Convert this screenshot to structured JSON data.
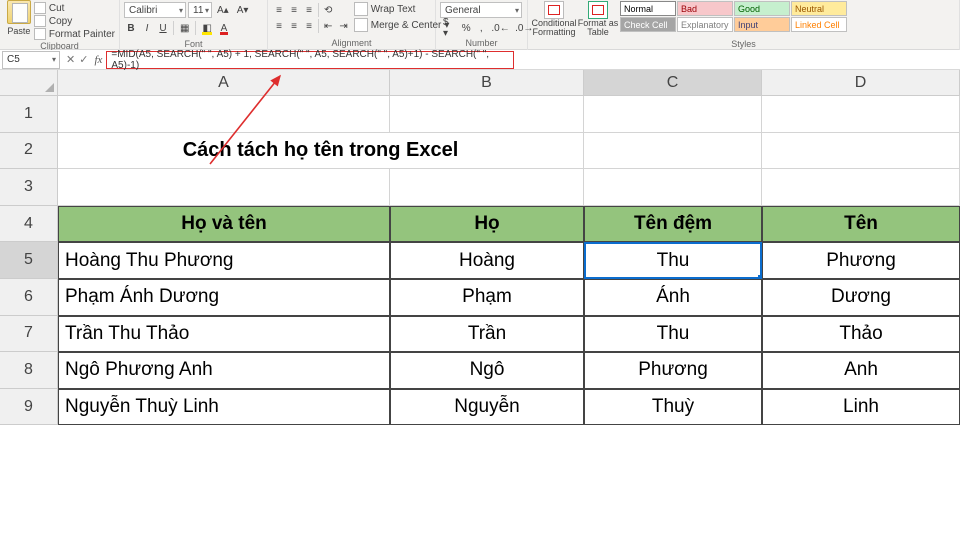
{
  "ribbon": {
    "clipboard": {
      "paste": "Paste",
      "cut": "Cut",
      "copy": "Copy",
      "painter": "Format Painter",
      "title": "Clipboard"
    },
    "font": {
      "family": "Calibri",
      "size": "11",
      "title": "Font"
    },
    "alignment": {
      "wrap": "Wrap Text",
      "merge": "Merge & Center",
      "title": "Alignment"
    },
    "number": {
      "format": "General",
      "title": "Number"
    },
    "styles": {
      "cond": "Conditional Formatting",
      "table": "Format as Table",
      "title": "Styles",
      "cells": [
        {
          "label": "Normal",
          "bg": "#ffffff",
          "fg": "#000"
        },
        {
          "label": "Bad",
          "bg": "#f7c7ca",
          "fg": "#9c0006"
        },
        {
          "label": "Good",
          "bg": "#c6efce",
          "fg": "#006100"
        },
        {
          "label": "Neutral",
          "bg": "#ffeb9c",
          "fg": "#9c5700"
        },
        {
          "label": "Check Cell",
          "bg": "#a5a5a5",
          "fg": "#ffffff"
        },
        {
          "label": "Explanatory …",
          "bg": "#ffffff",
          "fg": "#7f7f7f"
        },
        {
          "label": "Input",
          "bg": "#ffcc99",
          "fg": "#3f3f76"
        },
        {
          "label": "Linked Cell",
          "bg": "#ffffff",
          "fg": "#ff8001"
        }
      ]
    }
  },
  "namebox": "C5",
  "formula": "=MID(A5, SEARCH(\" \", A5) + 1, SEARCH(\" \", A5, SEARCH(\" \", A5)+1) - SEARCH(\" \", A5)-1)",
  "columns": [
    "A",
    "B",
    "C",
    "D"
  ],
  "rows": [
    "1",
    "2",
    "3",
    "4",
    "5",
    "6",
    "7",
    "8",
    "9"
  ],
  "title": "Cách tách họ tên trong Excel",
  "headers": {
    "A": "Họ và tên",
    "B": "Họ",
    "C": "Tên đệm",
    "D": "Tên"
  },
  "table": [
    {
      "A": "Hoàng Thu Phương",
      "B": "Hoàng",
      "C": "Thu",
      "D": "Phương"
    },
    {
      "A": "Phạm Ánh Dương",
      "B": "Phạm",
      "C": "Ánh",
      "D": "Dương"
    },
    {
      "A": "Trần Thu Thảo",
      "B": "Trần",
      "C": "Thu",
      "D": "Thảo"
    },
    {
      "A": "Ngô Phương Anh",
      "B": "Ngô",
      "C": "Phương",
      "D": "Anh"
    },
    {
      "A": "Nguyễn Thuỳ Linh",
      "B": "Nguyễn",
      "C": "Thuỳ",
      "D": "Linh"
    }
  ],
  "selected": "C5",
  "accent_green": "#94c47d"
}
